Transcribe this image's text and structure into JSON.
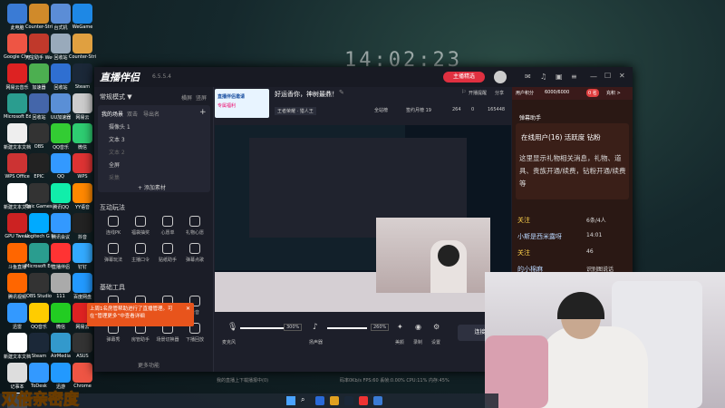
{
  "clock": "14:02:23",
  "desktop_icons": [
    {
      "label": "此电脑",
      "color": "#3a7bd5"
    },
    {
      "label": "Counter-Strike",
      "color": "#d08a2a"
    },
    {
      "label": "台式机",
      "color": "#5b8dd6"
    },
    {
      "label": "WeGame",
      "color": "#1e88e5"
    },
    {
      "label": "Google Chrome",
      "color": "#e54"
    },
    {
      "label": "元宝助手 WeGame",
      "color": "#c0392b"
    },
    {
      "label": "回收站",
      "color": "#9ab"
    },
    {
      "label": "Counter-Strike 2",
      "color": "#e0a040"
    },
    {
      "label": "网易云音乐",
      "color": "#d22"
    },
    {
      "label": "加速器",
      "color": "#4caf50"
    },
    {
      "label": "回收站",
      "color": "#2f6fd1"
    },
    {
      "label": "Steam",
      "color": "#1b2838"
    },
    {
      "label": "Microsoft Edge",
      "color": "#2a9d8f"
    },
    {
      "label": "回收站",
      "color": "#46a"
    },
    {
      "label": "UU加速器",
      "color": "#5a8fd6"
    },
    {
      "label": "网易云",
      "color": "#ccc"
    },
    {
      "label": "新建文本文档",
      "color": "#eee"
    },
    {
      "label": "OBS",
      "color": "#333"
    },
    {
      "label": "QQ音乐",
      "color": "#3c3"
    },
    {
      "label": "微信",
      "color": "#2ecc71"
    },
    {
      "label": "WPS Office",
      "color": "#c33"
    },
    {
      "label": "EPIC",
      "color": "#222"
    },
    {
      "label": "QQ",
      "color": "#39f"
    },
    {
      "label": "WPS",
      "color": "#d33"
    },
    {
      "label": "新建文本文档",
      "color": "#fff"
    },
    {
      "label": "Epic Games Launcher",
      "color": "#333"
    },
    {
      "label": "腾讯QQ",
      "color": "#1ea"
    },
    {
      "label": "YY语音",
      "color": "#f80"
    },
    {
      "label": "GPU Tweak",
      "color": "#c22"
    },
    {
      "label": "Logitech G HUB",
      "color": "#0af"
    },
    {
      "label": "腾讯会议",
      "color": "#39f"
    },
    {
      "label": "抖音",
      "color": "#222"
    },
    {
      "label": "斗鱼直播",
      "color": "#f60"
    },
    {
      "label": "Microsoft Edge",
      "color": "#2a9d8f"
    },
    {
      "label": "直播伴侣",
      "color": "#f33"
    },
    {
      "label": "钉钉",
      "color": "#3af"
    },
    {
      "label": "腾讯视频",
      "color": "#f60"
    },
    {
      "label": "OBS Studio",
      "color": "#333"
    },
    {
      "label": "111",
      "color": "#aaa"
    },
    {
      "label": "百度网盘",
      "color": "#29f"
    },
    {
      "label": "迅雷",
      "color": "#39f"
    },
    {
      "label": "QQ音乐",
      "color": "#fc0"
    },
    {
      "label": "微信",
      "color": "#2c2"
    },
    {
      "label": "网易云",
      "color": "#d22"
    },
    {
      "label": "新建文本文档",
      "color": "#fff"
    },
    {
      "label": "Steam",
      "color": "#1b2838"
    },
    {
      "label": "AirMedia",
      "color": "#39c"
    },
    {
      "label": "ASUS",
      "color": "#333"
    },
    {
      "label": "记事本",
      "color": "#ddd"
    },
    {
      "label": "ToDesk",
      "color": "#39f"
    },
    {
      "label": "迅游",
      "color": "#29f"
    },
    {
      "label": "Chrome",
      "color": "#e54"
    },
    {
      "label": "新建文本文档",
      "color": "#fff"
    }
  ],
  "app": {
    "name": "直播伴侣",
    "version": "6.5.5.4",
    "live_btn": "主播精选",
    "title_text": "好运香你，神树最鼎！",
    "banner": {
      "line1": "直播伴侣邀请",
      "line2": "专属福利"
    },
    "subline": "王者荣耀 · 猎人王",
    "stats": {
      "check": "全站榜",
      "likes": "签约月榜 19",
      "fans": "264",
      "count": "0",
      "viewers": "165448"
    },
    "top_actions": {
      "open": "开播提醒",
      "share": "分享"
    },
    "user_points": "用户积分",
    "points_value": "6000/6000",
    "rank": "0 名",
    "points_btn": "充积 >",
    "mode": "常规模式 ▼",
    "mode_tabs": [
      "横屏",
      "竖屏"
    ],
    "scene_tabs": [
      "我的场景",
      "双击",
      "导出名"
    ],
    "sources": [
      "摄像头 1",
      "文本 3",
      "文本 2",
      "全屏",
      "采集"
    ],
    "add_source": "+ 添加素材",
    "interact_title": "互动玩法",
    "interact": [
      "连线PK",
      "福袋抽奖",
      "心愿单",
      "礼物心愿",
      "弹幕玩法",
      "主播口令",
      "贴纸助手",
      "弹幕点歌"
    ],
    "tools_title": "基础工具",
    "tools": [
      "直播间设置",
      "任务",
      "房管",
      "录音",
      "弹幕秀",
      "房管助手",
      "场景切换器",
      "下播回放"
    ],
    "more": "更多功能",
    "tip": "上周1名房管帮助进行了直播管理。可在“管理更多”中查看详细",
    "controls": {
      "mic": "麦克风",
      "mic_vol": "300%",
      "speaker": "扬声器",
      "spk_vol": "260%",
      "beauty": "美颜",
      "record": "录制",
      "settings": "设置",
      "start": "连接中"
    },
    "status": "我的直播上下载播报中(0)",
    "perf": "码率0Kb/s  FPS:60  丢帧:0.00%  CPU:11%  内存:45%",
    "danmu_title": "弹幕助手",
    "online": "在线用户(16)  活跃度  钻粉",
    "online_note": "这里显示礼物相关消息，礼物、道具、贵族开通/续费，钻粉开通/续费等",
    "chat": [
      {
        "name": "关注",
        "text": "6条/4人"
      },
      {
        "name": "小斯是西米露呀",
        "text": "14:01"
      },
      {
        "name": "关注",
        "text": "46"
      },
      {
        "name": "的小棉麻",
        "text": "识别图说话"
      }
    ]
  },
  "watermark": "双倍亲密度"
}
